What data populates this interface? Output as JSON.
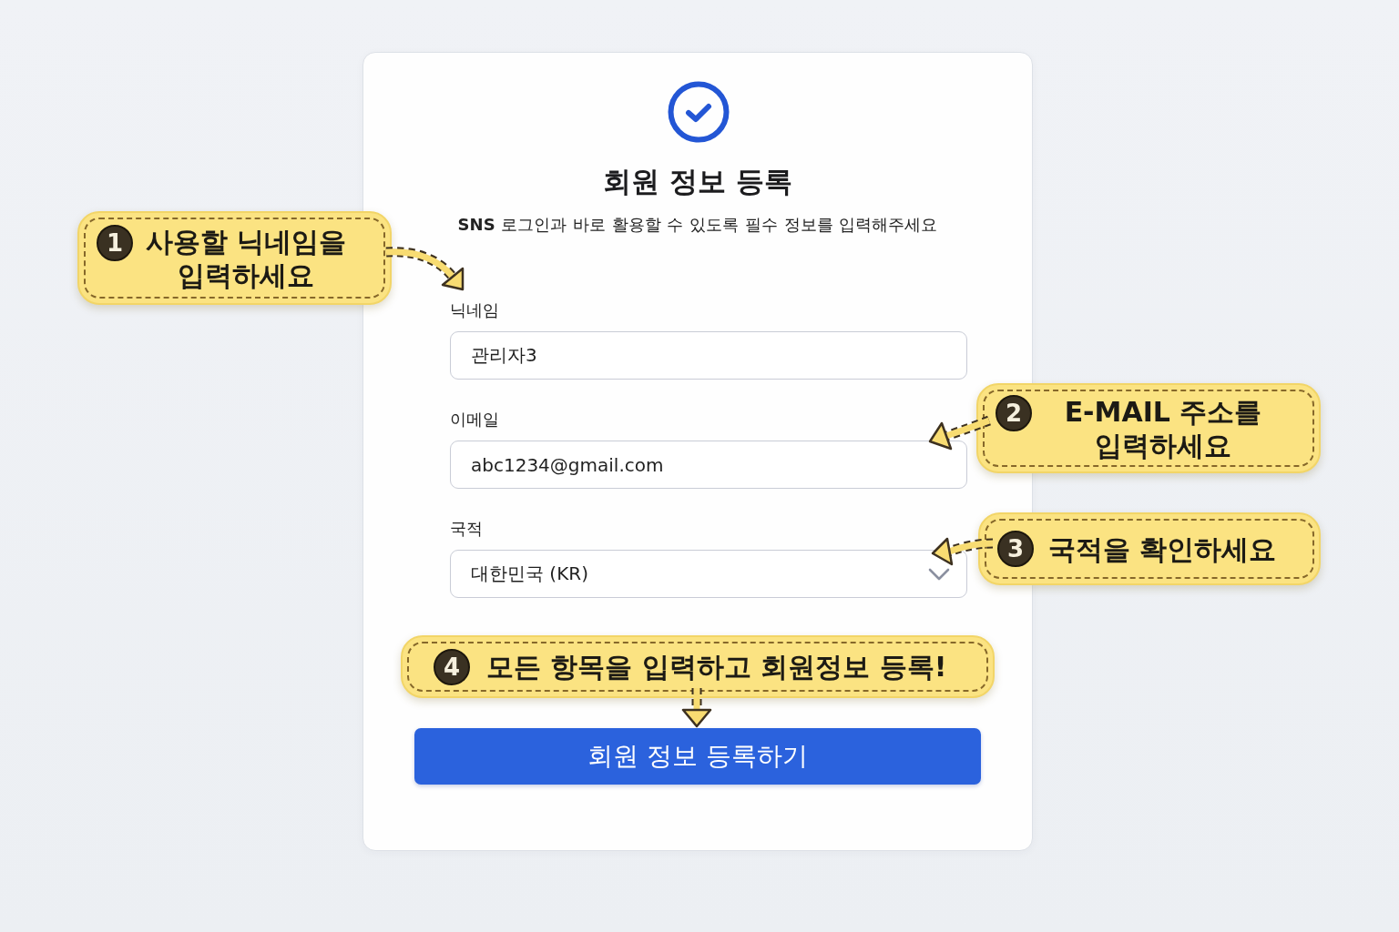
{
  "form": {
    "title": "회원 정보 등록",
    "subtitle": "**SNS** 로그인과 바로 활용할 수 있도록 필수 정보를 입력해주세요",
    "fields": [
      {
        "kind": "text",
        "label": "닉네임",
        "value": "관리자3"
      },
      {
        "kind": "text",
        "label": "이메일",
        "value": "abc1234@gmail.com"
      },
      {
        "kind": "select",
        "label": "국적",
        "value": "대한민국 (KR)"
      }
    ],
    "submit_button": "회원 정보 등록하기"
  },
  "callouts": [
    {
      "number": "1",
      "text": "사용할 닉네임을 입력하세요"
    },
    {
      "number": "2",
      "text": "E-MAIL 주소를 입력하세요"
    },
    {
      "number": "3",
      "text": "국적을 확인하세요"
    },
    {
      "number": "4",
      "text": "모든 항목을 입력하고 회원정보 등록!"
    }
  ]
}
